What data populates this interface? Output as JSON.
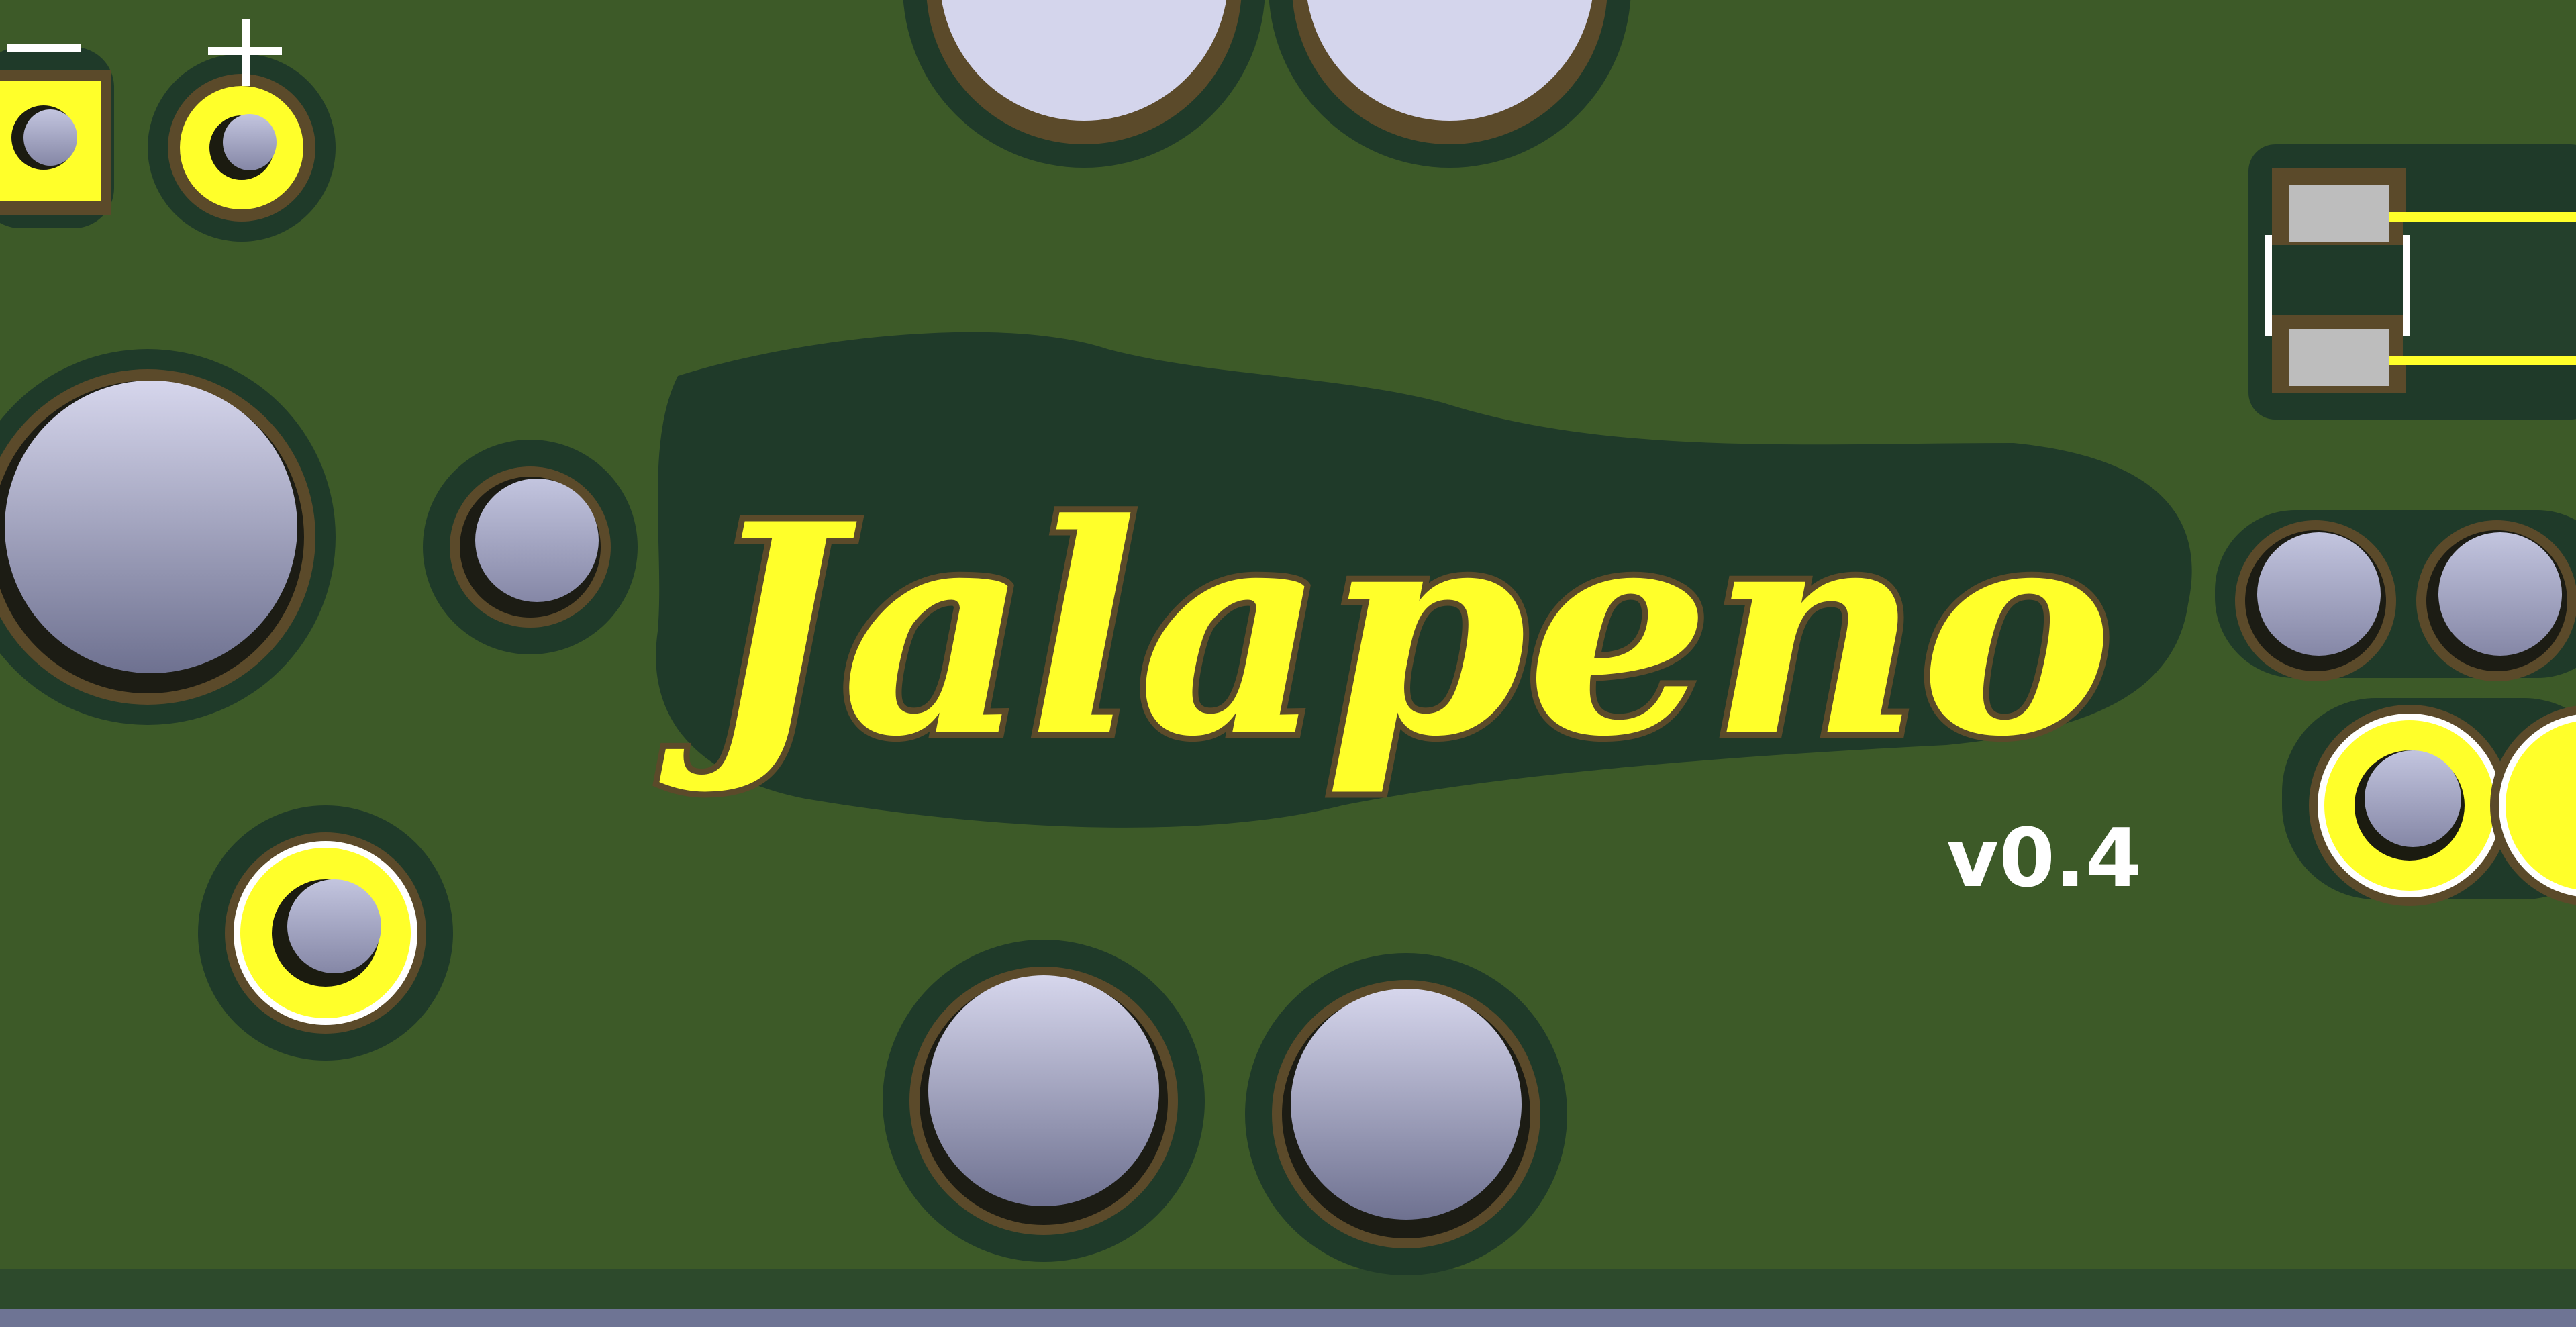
{
  "board": {
    "logo_text": "Jalapeno",
    "version_label": "v0.4",
    "minus_label": "−",
    "plus_label": "+"
  },
  "colors": {
    "board_green": "#3d5a28",
    "mask_dark": "#1f3a29",
    "copper_outline": "#5b4a2a",
    "gold_silk": "#ffff2a",
    "silk_white": "#ffffff",
    "hole_light": "#c9cbe2",
    "hole_dark": "#6f7292",
    "pad_grey": "#bdbdbd"
  }
}
